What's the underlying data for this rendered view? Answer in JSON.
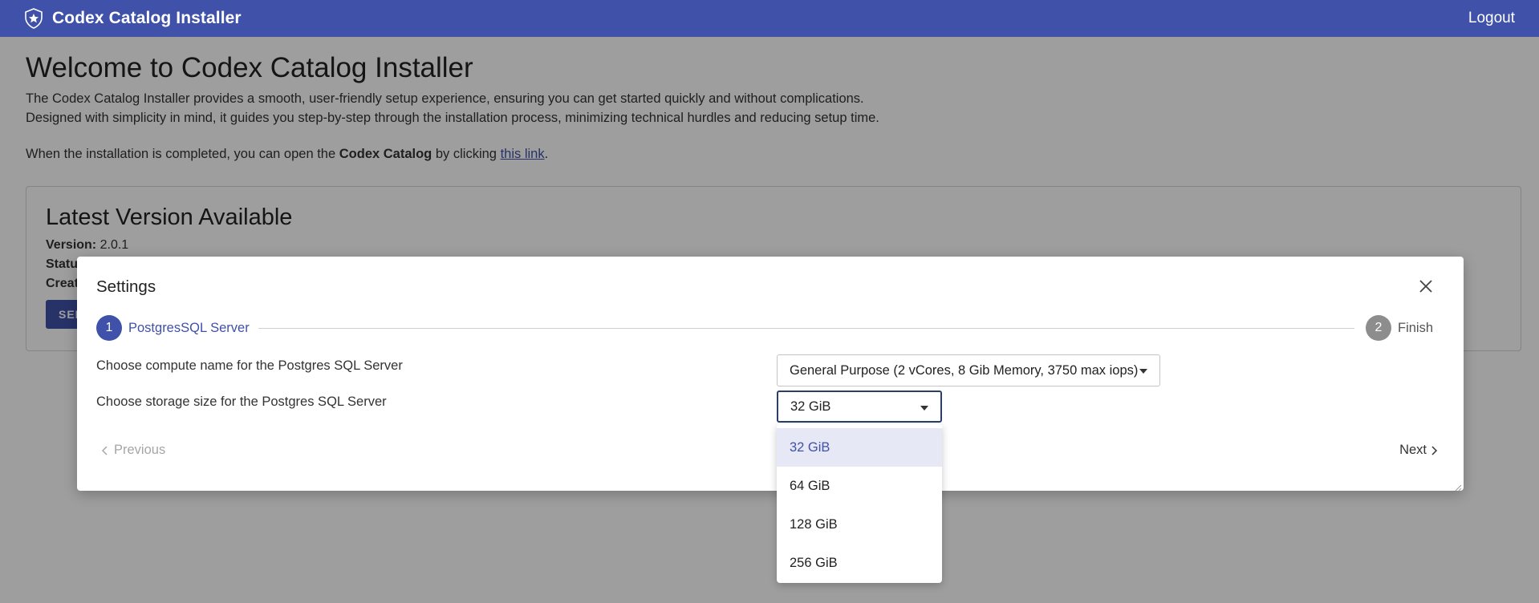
{
  "topbar": {
    "app_title": "Codex Catalog Installer",
    "logo_icon": "shield-icon",
    "logout_label": "Logout",
    "background_color": "#3f51a8"
  },
  "welcome": {
    "title": "Welcome to Codex Catalog Installer",
    "line1": "The Codex Catalog Installer provides a smooth, user-friendly setup experience, ensuring you can get started quickly and without complications.",
    "line2": "Designed with simplicity in mind, it guides you step-by-step through the installation process, minimizing technical hurdles and reducing setup time.",
    "note_prefix": "When the installation is completed, you can open the ",
    "note_bold": "Codex Catalog",
    "note_middle": " by clicking ",
    "note_link": "this link",
    "note_suffix": "."
  },
  "version_card": {
    "title": "Latest Version Available",
    "version_label": "Version:",
    "version_value": "2.0.1",
    "status_label": "Status",
    "created_label": "Creat",
    "select_button_label": "SELECT"
  },
  "modal": {
    "title": "Settings",
    "close_icon": "close-icon",
    "steps": [
      {
        "number": "1",
        "label": "PostgresSQL Server",
        "active": true
      },
      {
        "number": "2",
        "label": "Finish",
        "active": false
      }
    ],
    "compute_label": "Choose compute name for the Postgres SQL Server",
    "compute_value": "General Purpose (2 vCores, 8 Gib Memory, 3750 max iops)",
    "storage_label": "Choose storage size for the Postgres SQL Server",
    "storage_value": "32 GiB",
    "previous_label": "Previous",
    "next_label": "Next"
  },
  "storage_dropdown": {
    "options": [
      "32 GiB",
      "64 GiB",
      "128 GiB",
      "256 GiB"
    ],
    "selected": "32 GiB"
  }
}
